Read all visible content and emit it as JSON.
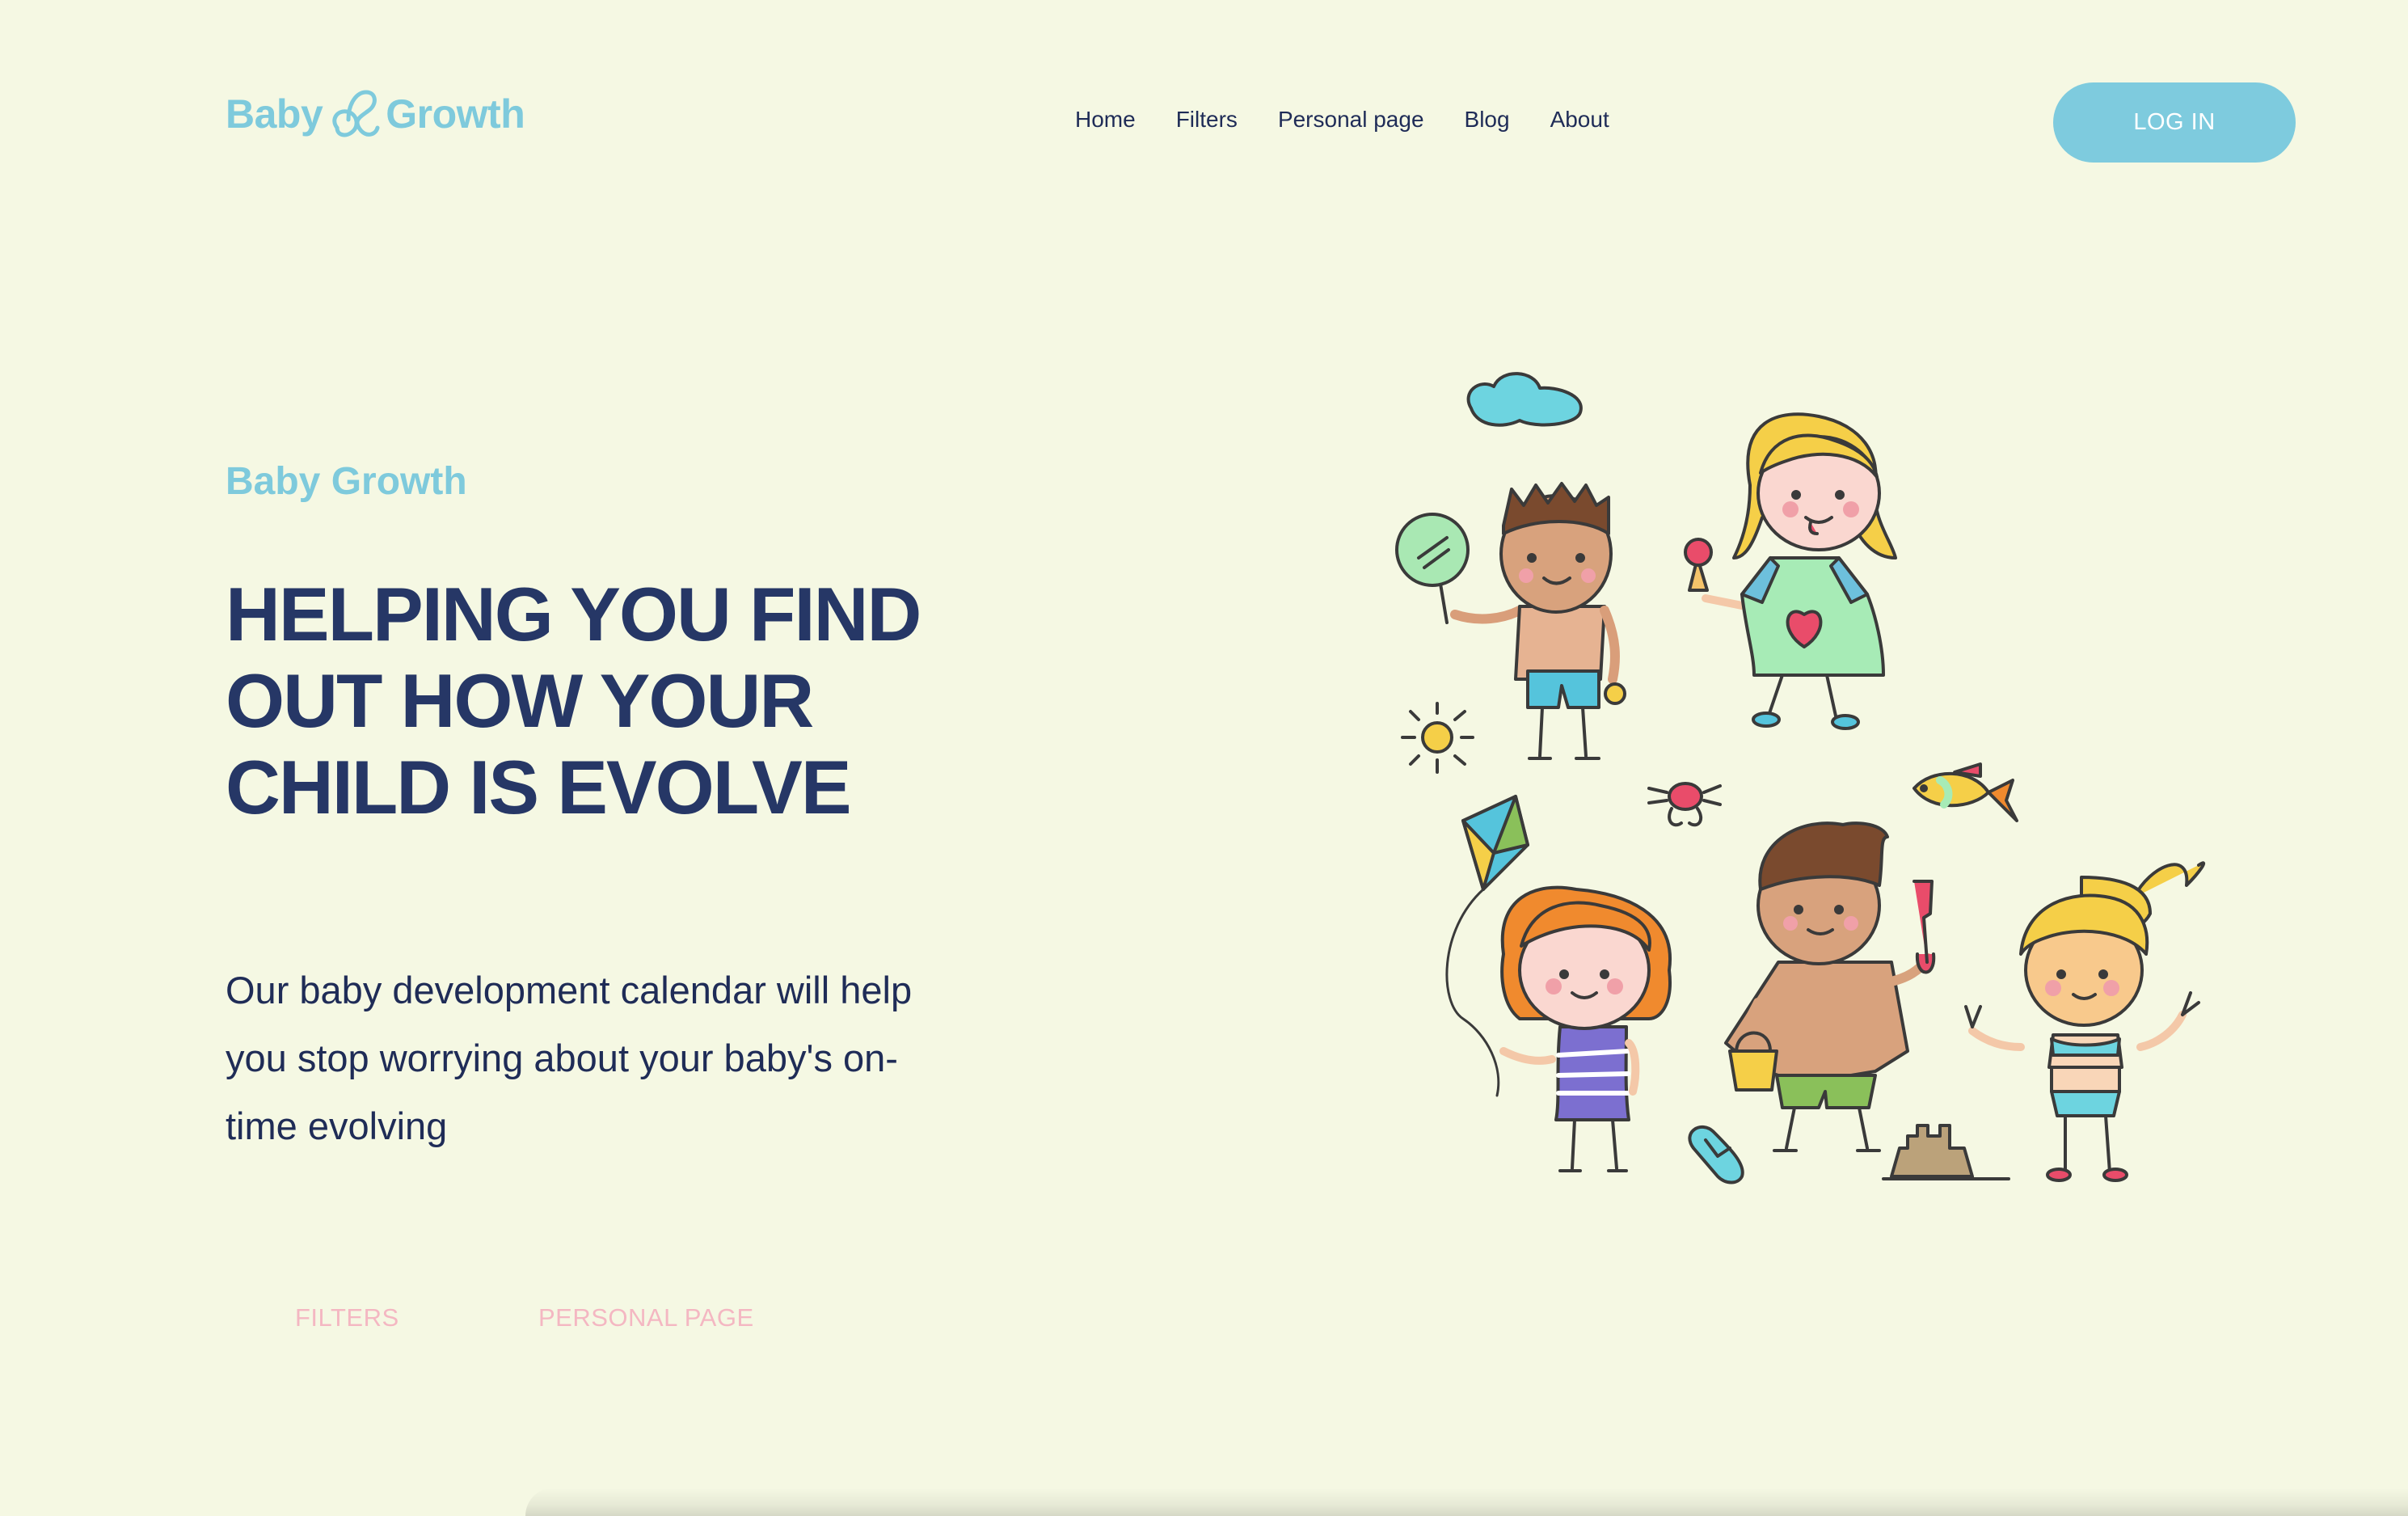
{
  "header": {
    "logo": {
      "left": "Baby",
      "right": "Growth"
    },
    "nav": [
      "Home",
      "Filters",
      "Personal page",
      "Blog",
      "About"
    ],
    "login_label": "LOG IN"
  },
  "hero": {
    "kicker": "Baby Growth",
    "headline": "HELPING YOU FIND OUT HOW YOUR CHILD IS EVOLVE",
    "description": "Our baby development calendar will help you stop worrying about your baby's on-time evolving",
    "buttons": {
      "filters": "FILTERS",
      "personal": "PERSONAL PAGE"
    }
  },
  "illustration": {
    "icon": "kids-playing-illustration"
  },
  "colors": {
    "background": "#f5f8e3",
    "accent": "#7ecbde",
    "navy": "#263766",
    "pink": "#f4b7c2"
  }
}
